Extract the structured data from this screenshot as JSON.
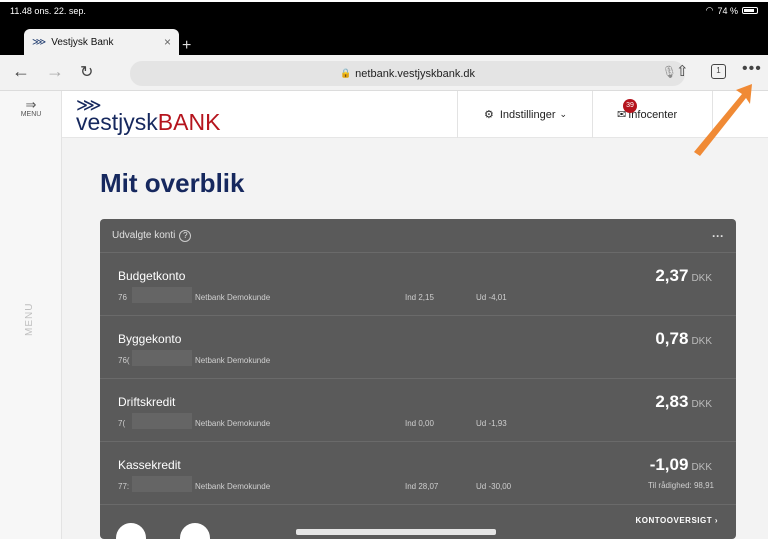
{
  "status": {
    "time": "11.48",
    "date": "ons. 22. sep.",
    "battery": "74 %"
  },
  "browser": {
    "tab_title": "Vestjysk Bank",
    "url": "netbank.vestjyskbank.dk",
    "tab_count": "1"
  },
  "sidebar": {
    "menu_label": "MENU",
    "side_label": "MENU"
  },
  "header": {
    "logo_part1": "vestjysk",
    "logo_part2": "BANK",
    "settings_label": "Indstillinger",
    "infocenter_label": "Infocenter",
    "infocenter_badge": "39"
  },
  "page": {
    "title": "Mit overblik"
  },
  "card": {
    "header_label": "Udvalgte konti",
    "overview_link": "KONTOOVERSIGT ›",
    "accounts": [
      {
        "name": "Budgetkonto",
        "number": "76",
        "holder": "Netbank Demokunde",
        "ind": "Ind 2,15",
        "ud": "Ud -4,01",
        "amount": "2,37",
        "currency": "DKK",
        "available": ""
      },
      {
        "name": "Byggekonto",
        "number": "76(",
        "holder": "Netbank Demokunde",
        "ind": "",
        "ud": "",
        "amount": "0,78",
        "currency": "DKK",
        "available": ""
      },
      {
        "name": "Driftskredit",
        "number": "7(",
        "holder": "Netbank Demokunde",
        "ind": "Ind 0,00",
        "ud": "Ud -1,93",
        "amount": "2,83",
        "currency": "DKK",
        "available": ""
      },
      {
        "name": "Kassekredit",
        "number": "77:",
        "holder": "Netbank Demokunde",
        "ind": "Ind 28,07",
        "ud": "Ud -30,00",
        "amount": "-1,09",
        "currency": "DKK",
        "available": "Til rådighed: 98,91"
      }
    ]
  },
  "colors": {
    "brand_navy": "#16285e",
    "brand_red": "#b5141d",
    "card_bg": "#5a5a5a",
    "pointer": "#f08a35"
  }
}
